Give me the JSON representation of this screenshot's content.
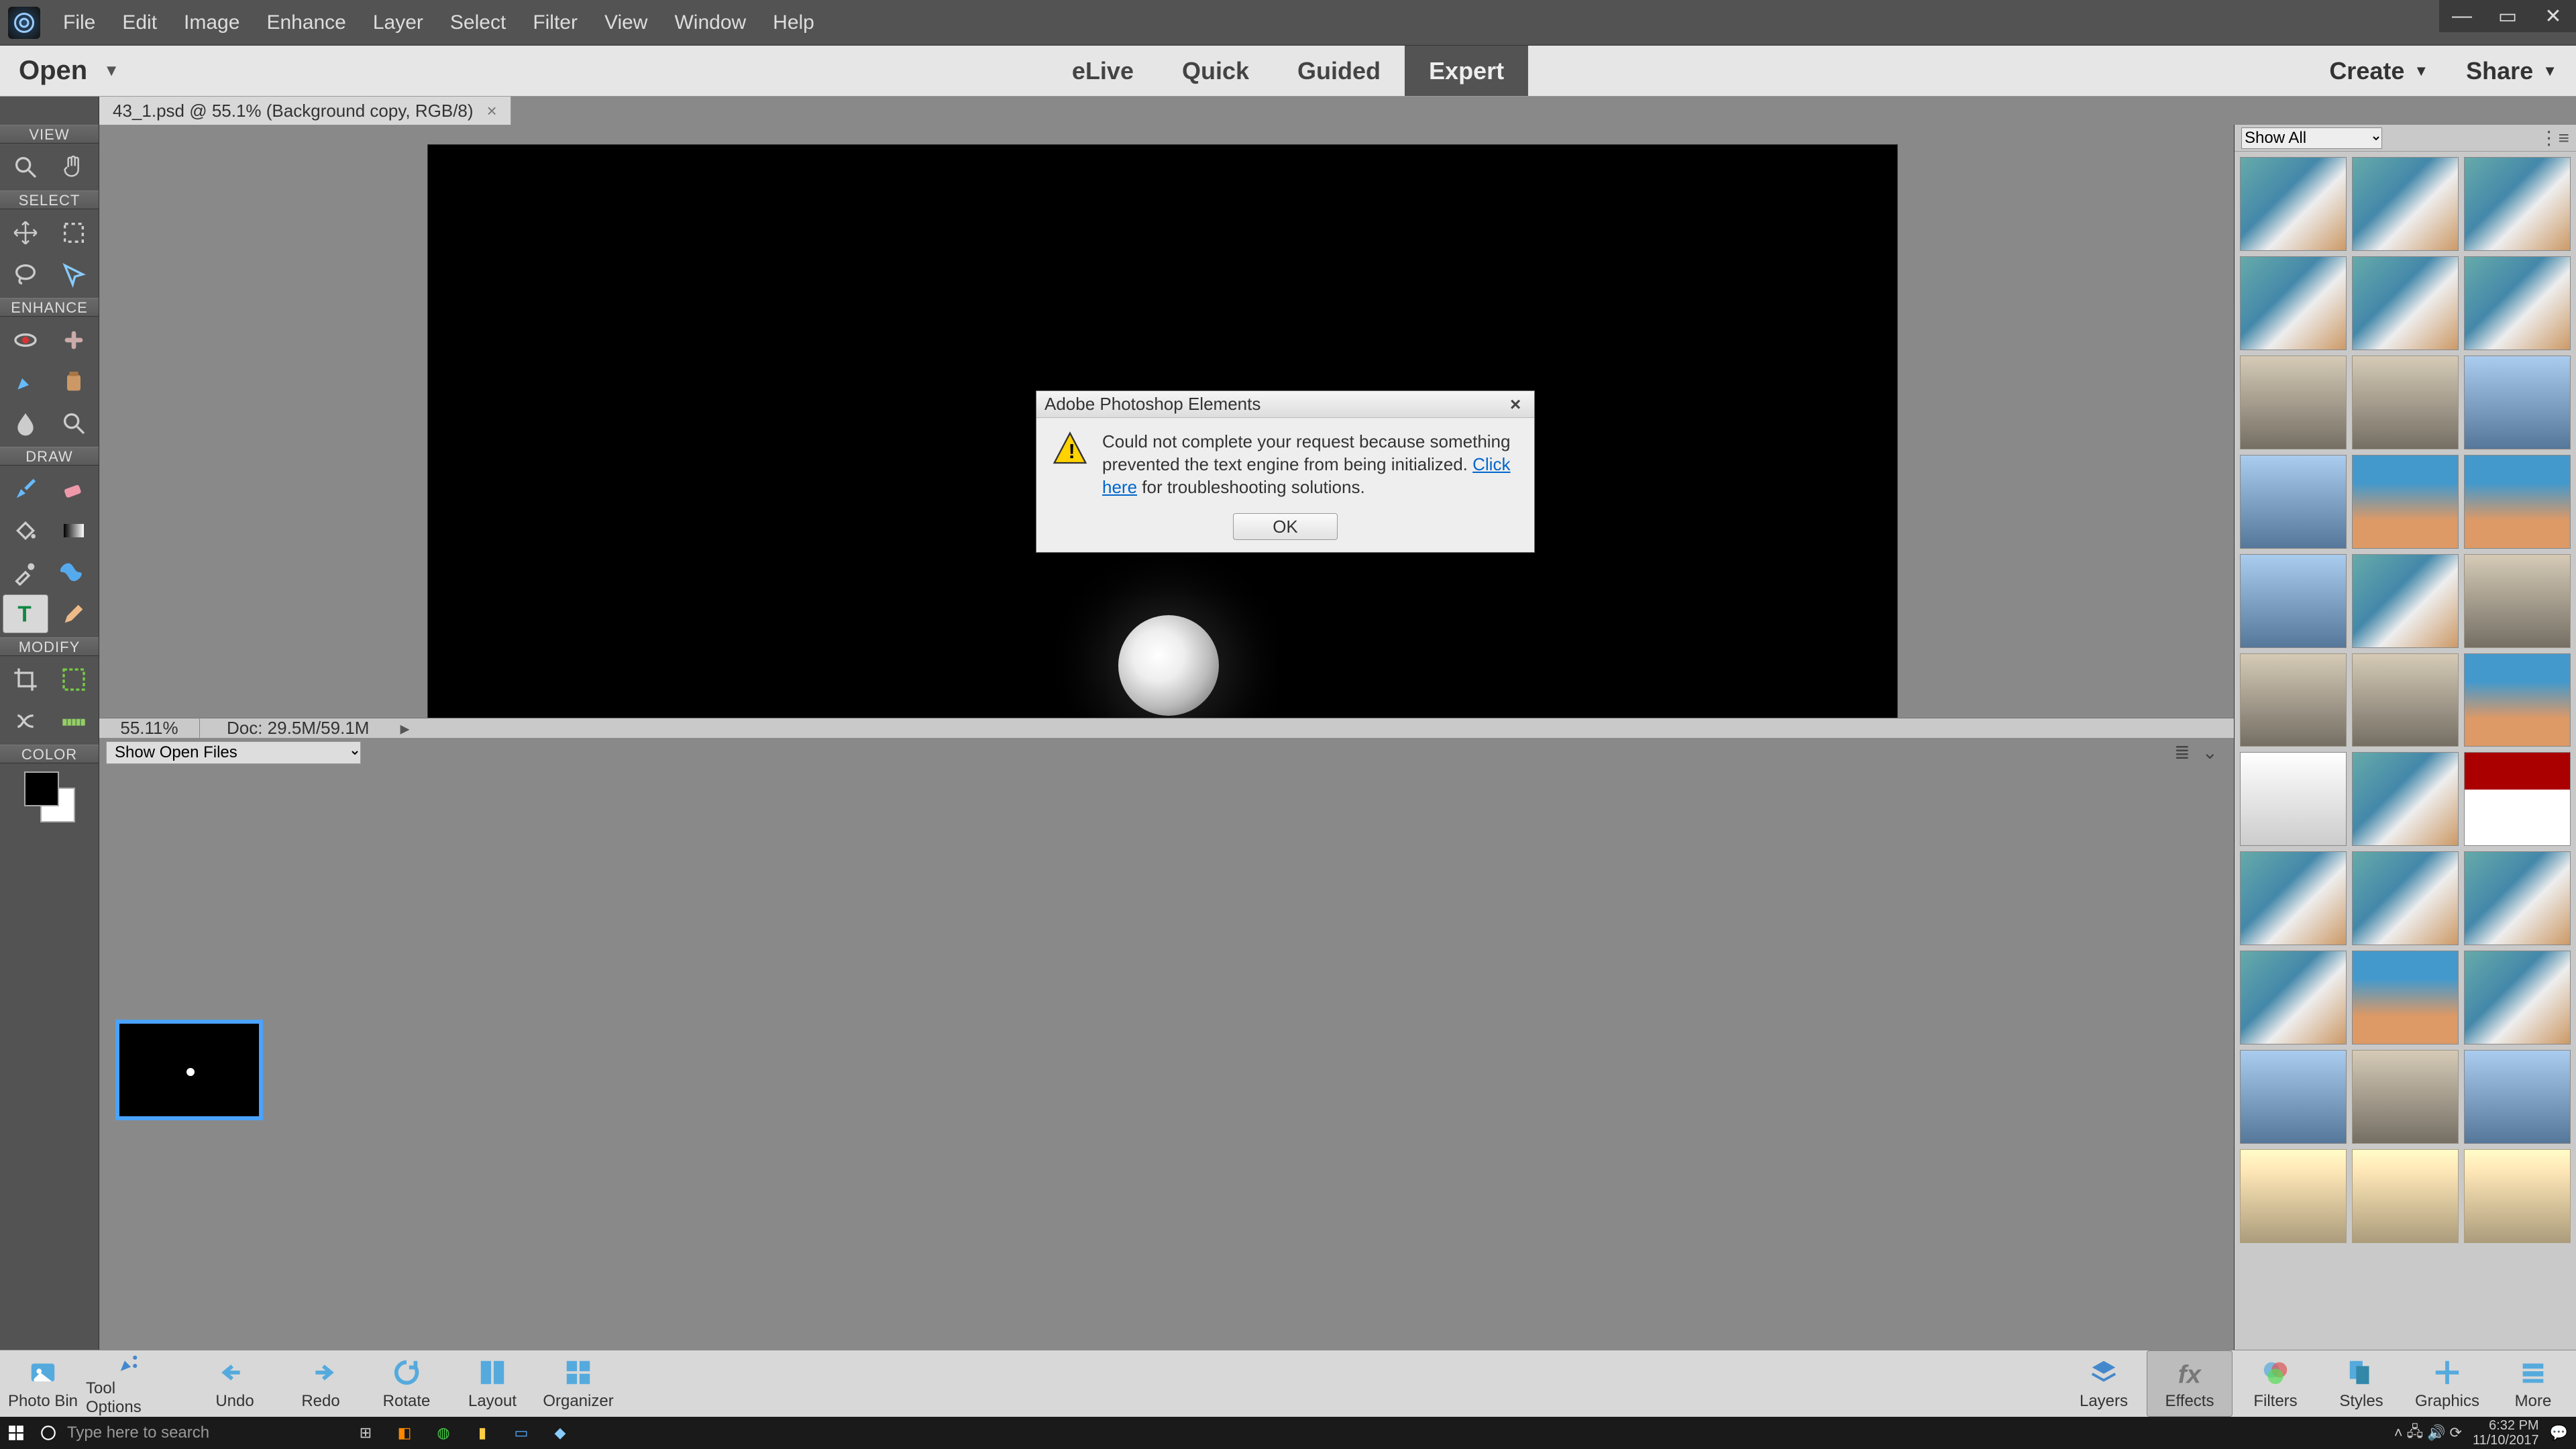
{
  "menubar": {
    "items": [
      "File",
      "Edit",
      "Image",
      "Enhance",
      "Layer",
      "Select",
      "Filter",
      "View",
      "Window",
      "Help"
    ]
  },
  "toolbar": {
    "open": "Open",
    "modes": [
      "eLive",
      "Quick",
      "Guided",
      "Expert"
    ],
    "active_mode": 3,
    "create": "Create",
    "share": "Share"
  },
  "tab": {
    "title": "43_1.psd @ 55.1% (Background copy, RGB/8)"
  },
  "tools": {
    "view": "VIEW",
    "select": "SELECT",
    "enhance": "ENHANCE",
    "draw": "DRAW",
    "modify": "MODIFY",
    "color": "COLOR"
  },
  "status": {
    "zoom": "55.11%",
    "doc": "Doc: 29.5M/59.1M"
  },
  "filebar": {
    "label": "Show Open Files"
  },
  "filter_dropdown": "Show All",
  "dialog": {
    "title": "Adobe Photoshop Elements",
    "msg1": "Could not complete your request because something prevented the text engine from being initialized. ",
    "link": "Click here",
    "msg2": "  for troubleshooting solutions.",
    "ok": "OK"
  },
  "bottom": {
    "items": [
      "Photo Bin",
      "Tool Options",
      "Undo",
      "Redo",
      "Rotate",
      "Layout",
      "Organizer"
    ],
    "right": [
      "Layers",
      "Effects",
      "Filters",
      "Styles",
      "Graphics",
      "More"
    ],
    "active_right": 1
  },
  "taskbar": {
    "search": "Type here to search",
    "time": "6:32 PM",
    "date": "11/10/2017"
  }
}
